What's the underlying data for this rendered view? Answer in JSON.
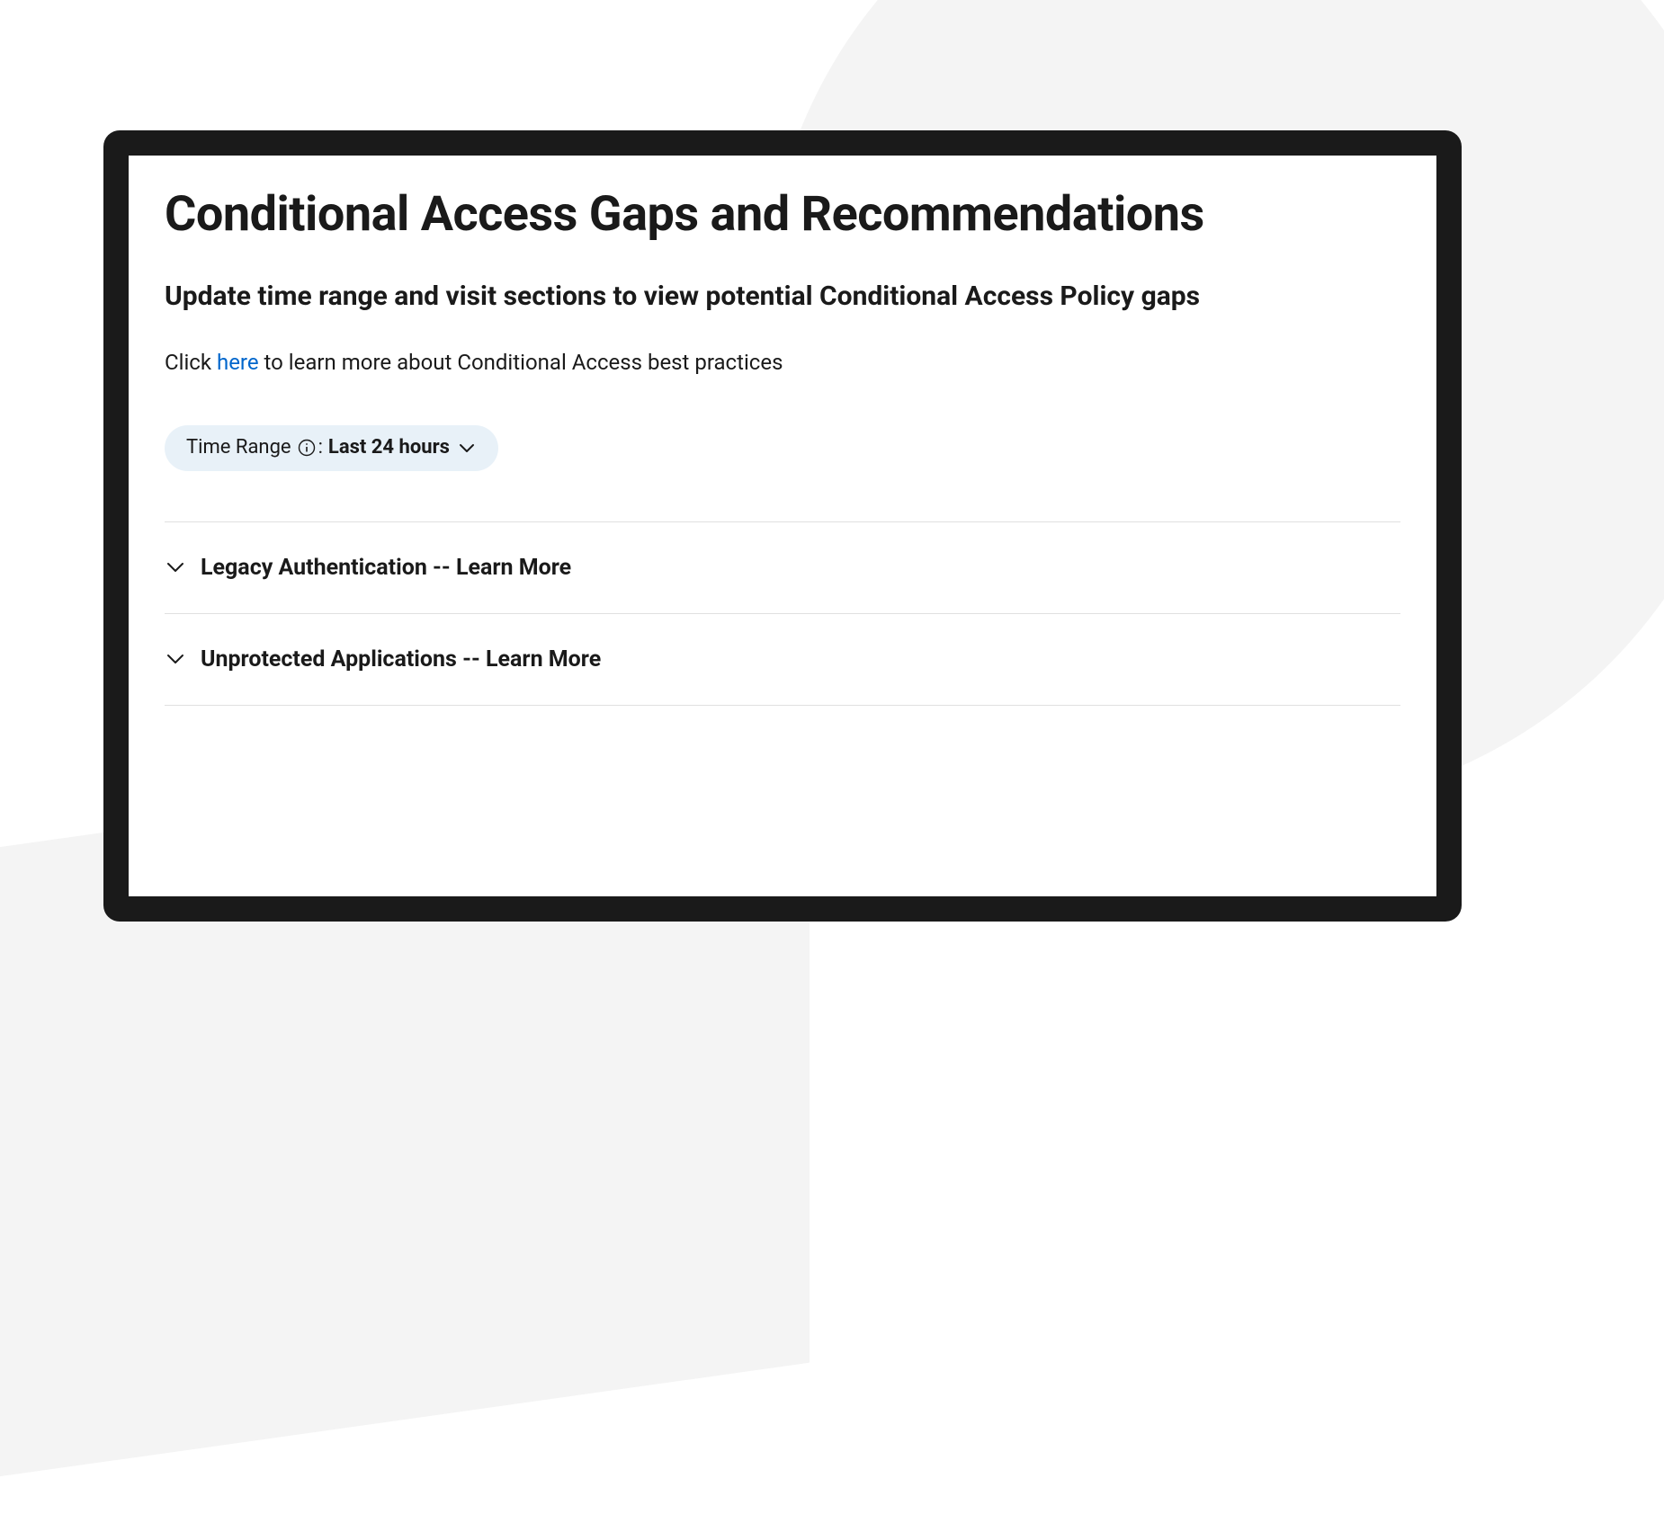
{
  "header": {
    "title": "Conditional Access Gaps and Recommendations",
    "subtitle": "Update time range and visit sections to view potential Conditional Access Policy gaps",
    "help_prefix": "Click ",
    "help_link": "here",
    "help_suffix": " to learn more about Conditional Access best practices"
  },
  "filter": {
    "label": "Time Range",
    "value": "Last 24 hours"
  },
  "sections": [
    {
      "title": "Legacy Authentication -- Learn More"
    },
    {
      "title": "Unprotected Applications -- Learn More"
    }
  ]
}
